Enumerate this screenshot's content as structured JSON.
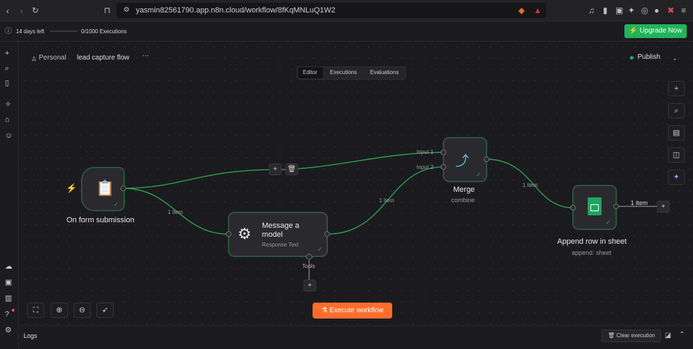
{
  "browser": {
    "url": "yasmin82561790.app.n8n.cloud/workflow/8fKqMNLuQ1W2"
  },
  "trial": {
    "days_left": "14 days left",
    "executions": "0/1000 Executions",
    "upgrade_label": "Upgrade Now"
  },
  "header": {
    "project": "Personal",
    "workflow_name": "lead capture flow",
    "more": "···",
    "publish": "Publish"
  },
  "tabs": [
    "Editor",
    "Executions",
    "Evaluations"
  ],
  "nodes": {
    "form": {
      "label": "On form submission"
    },
    "model": {
      "title_line1": "Message a",
      "title_line2": "model",
      "subtitle": "Response Text",
      "tools": "Tools"
    },
    "merge": {
      "label": "Merge",
      "subtitle": "combine",
      "input1": "Input 1",
      "input2": "Input 2"
    },
    "sheet": {
      "label": "Append row in sheet",
      "subtitle": "append: sheet"
    }
  },
  "edges": {
    "form_model": "1 item",
    "model_merge": "1 item",
    "merge_sheet": "1 item",
    "sheet_out": "1 item"
  },
  "execute_label": "Execute workflow",
  "logs": {
    "title": "Logs",
    "clear_label": "Clear execution"
  },
  "colors": {
    "accent_green": "#22b35a",
    "execute_orange": "#ff6d2d",
    "edge": "#2ea04f"
  }
}
